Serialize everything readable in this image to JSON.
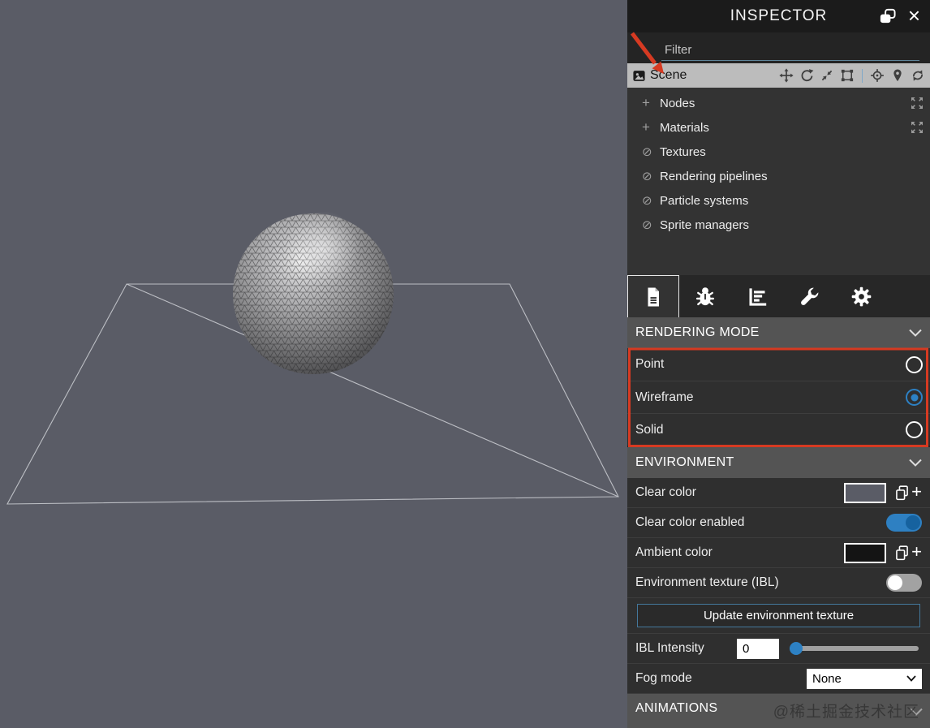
{
  "colors": {
    "accent_blue": "#2d81c4",
    "annotation_red": "#d63a22",
    "scene_background": "#5a5c66",
    "clear_color_value": "#5a5c66",
    "ambient_color_value": "#141414"
  },
  "titlebar": {
    "title": "INSPECTOR",
    "icons": [
      "popout-icon",
      "close-icon"
    ]
  },
  "filter": {
    "placeholder": "Filter"
  },
  "scene_row": {
    "label": "Scene",
    "icons": [
      "image-icon",
      "move-icon",
      "rotate-icon",
      "scale-icon",
      "bounding-box-icon",
      "picker-icon",
      "location-pin-icon",
      "refresh-icon"
    ]
  },
  "tree": [
    {
      "label": "Nodes",
      "prefix": "plus",
      "expandable": true
    },
    {
      "label": "Materials",
      "prefix": "plus",
      "expandable": true
    },
    {
      "label": "Textures",
      "prefix": "no-entry",
      "expandable": false
    },
    {
      "label": "Rendering pipelines",
      "prefix": "no-entry",
      "expandable": false
    },
    {
      "label": "Particle systems",
      "prefix": "no-entry",
      "expandable": false
    },
    {
      "label": "Sprite managers",
      "prefix": "no-entry",
      "expandable": false
    }
  ],
  "tabs": [
    {
      "icon": "file-icon",
      "active": true
    },
    {
      "icon": "bug-icon",
      "active": false
    },
    {
      "icon": "stats-icon",
      "active": false
    },
    {
      "icon": "wrench-icon",
      "active": false
    },
    {
      "icon": "gear-icon",
      "active": false
    }
  ],
  "rendering_mode": {
    "title": "RENDERING MODE",
    "options": [
      {
        "label": "Point",
        "selected": false
      },
      {
        "label": "Wireframe",
        "selected": true
      },
      {
        "label": "Solid",
        "selected": false
      }
    ]
  },
  "environment": {
    "title": "ENVIRONMENT",
    "clear_color_label": "Clear color",
    "clear_color_enabled_label": "Clear color enabled",
    "clear_color_enabled": true,
    "ambient_color_label": "Ambient color",
    "ibl_toggle_label": "Environment texture (IBL)",
    "ibl_toggle_enabled": false,
    "update_button_label": "Update environment texture",
    "ibl_intensity_label": "IBL Intensity",
    "ibl_intensity_value": "0",
    "fog_mode_label": "Fog mode",
    "fog_mode_value": "None"
  },
  "animations": {
    "title": "ANIMATIONS"
  },
  "watermark": "@稀土掘金技术社区",
  "viewport": {
    "objects": [
      "wireframe-sphere",
      "ground-plane-wireframe"
    ]
  }
}
